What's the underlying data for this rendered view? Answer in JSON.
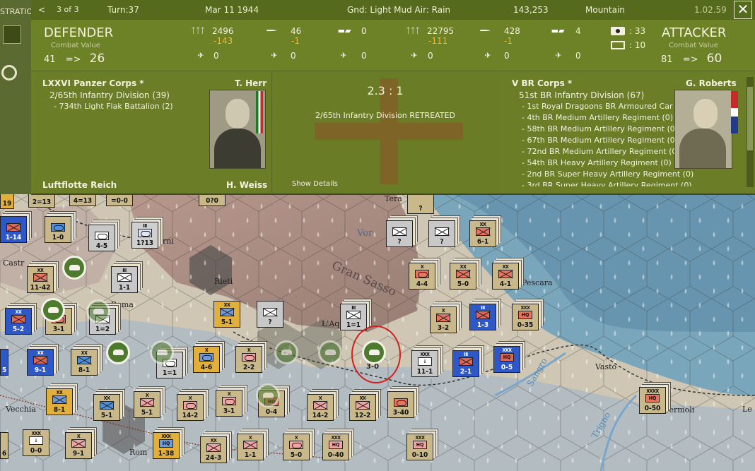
{
  "topbar": {
    "left_title": "STRATIO",
    "nav_prev": "<",
    "page": "3 of 3",
    "turn": "Turn:37",
    "date": "Mar 11 1944",
    "ground": "Gnd: Light Mud  Air: Rain",
    "hex_coord": "143,253",
    "terrain": "Mountain",
    "version": "1.02.59",
    "close": "✕"
  },
  "defender": {
    "heading": "DEFENDER",
    "sub": "Combat Value",
    "cv_from": "41",
    "arrow": "=>",
    "cv_to": "26",
    "men": "2496",
    "men_delta": "-143",
    "guns": "46",
    "guns_delta": "-1",
    "tanks": "0",
    "air1": "0",
    "air2": "0",
    "air3": "0",
    "corps": "LXXVI Panzer Corps *",
    "commander": "T. Herr",
    "division": "2/65th Infantry Division (39)",
    "attached": "- 734th Light Flak Battalion (2)",
    "air_group": "Luftflotte Reich",
    "air_cmdr": "H. Weiss"
  },
  "attacker": {
    "heading": "ATTACKER",
    "sub": "Combat Value",
    "cv_from": "81",
    "arrow": "=>",
    "cv_to": "60",
    "men": "22795",
    "men_delta": "-111",
    "guns": "428",
    "guns_delta": "-1",
    "tanks": "4",
    "air1": "0",
    "air2": "0",
    "air3": "0",
    "fort_value": ": 33",
    "entrench_value": ": 10",
    "corps": "V BR Corps *",
    "commander": "G. Roberts",
    "division": "51st BR Infantry Division (67)",
    "attached": [
      "- 1st Royal Dragoons BR Armoured Car Regiment (8)",
      "- 4th BR Medium Artillery Regiment (0)",
      "- 58th BR Medium Artillery Regiment (0)",
      "- 67th BR Medium Artillery Regiment (0)",
      "- 72nd BR Medium Artillery Regiment (0)",
      "- 54th BR Heavy Artillery Regiment (0)",
      "- 2nd BR Super Heavy Artillery Regiment (0)",
      "- 3rd BR Super Heavy Artillery Regiment (0)"
    ]
  },
  "result": {
    "odds": "2.3 : 1",
    "message": "2/65th Infantry Division RETREATED",
    "details_link": "Show Details"
  },
  "map": {
    "labels": [
      "Rieti",
      "L'Aq",
      "Gran Sasso",
      "Vasto",
      "Pescara",
      "Termoli",
      "Tera",
      "Castr",
      "Roma",
      "Rom",
      "Vecchia",
      "Le",
      "rni",
      "Sangro",
      "Trigno",
      "Vor"
    ],
    "units": [
      {
        "type": "u-blu",
        "size": "",
        "sym": "x",
        "val": "1-14"
      },
      {
        "type": "u-tan",
        "size": "",
        "sym": "ar",
        "val": "1-0"
      },
      {
        "type": "u-wht",
        "size": "",
        "sym": "ar",
        "val": "4-5"
      },
      {
        "type": "u-gray",
        "size": "III",
        "sym": "ar",
        "val": "1?13"
      },
      {
        "type": "u-tan",
        "size": "XX",
        "sym": "x",
        "val": "11-42"
      },
      {
        "type": "u-wht",
        "size": "III",
        "sym": "x",
        "val": "1-1"
      },
      {
        "type": "u-blu",
        "size": "XX",
        "sym": "x",
        "val": "5-2"
      },
      {
        "type": "u-tan",
        "size": "",
        "sym": "ar",
        "val": "3-1"
      },
      {
        "type": "u-wht",
        "size": "",
        "sym": "x",
        "val": "1=2"
      },
      {
        "type": "u-yel",
        "size": "XX",
        "sym": "x",
        "val": "5-1"
      },
      {
        "type": "u-wht",
        "size": "",
        "sym": "x",
        "val": "?"
      },
      {
        "type": "u-wht",
        "size": "III",
        "sym": "x",
        "val": "1=1"
      },
      {
        "type": "u-wht",
        "size": "",
        "sym": "x",
        "val": "?"
      },
      {
        "type": "u-wht",
        "size": "",
        "sym": "x",
        "val": "?"
      },
      {
        "type": "u-tan",
        "size": "XX",
        "sym": "x",
        "val": "6-1"
      },
      {
        "type": "u-tan",
        "size": "X",
        "sym": "ar",
        "val": "4-4"
      },
      {
        "type": "u-tan",
        "size": "XX",
        "sym": "x",
        "val": "5-0"
      },
      {
        "type": "u-tan",
        "size": "XX",
        "sym": "x",
        "val": "4-1"
      },
      {
        "type": "u-tan",
        "size": "X",
        "sym": "x",
        "val": "3-2"
      },
      {
        "type": "u-blu",
        "size": "III",
        "sym": "x",
        "val": "1-3"
      },
      {
        "type": "u-tan",
        "size": "XXX",
        "sym": "hq",
        "val": "0-35"
      },
      {
        "type": "u-blu",
        "size": "XX",
        "sym": "x",
        "val": "9-1"
      },
      {
        "type": "u-gb",
        "size": "XX",
        "sym": "x",
        "val": "8-1"
      },
      {
        "type": "u-wht",
        "size": "",
        "sym": "ar",
        "val": "1=1"
      },
      {
        "type": "u-yel",
        "size": "X",
        "sym": "ar",
        "val": "4-6"
      },
      {
        "type": "u-pink",
        "size": "X",
        "sym": "ar",
        "val": "2-2"
      },
      {
        "type": "u-wht",
        "size": "XXX",
        "sym": "hq",
        "val": "11-1"
      },
      {
        "type": "u-blu",
        "size": "III",
        "sym": "x",
        "val": "2-1"
      },
      {
        "type": "u-blu",
        "size": "XXX",
        "sym": "hq",
        "val": "0-5"
      },
      {
        "type": "u-yel",
        "size": "XX",
        "sym": "x",
        "val": "8-1"
      },
      {
        "type": "u-gb",
        "size": "XX",
        "sym": "x",
        "val": "5-1"
      },
      {
        "type": "u-pink",
        "size": "X",
        "sym": "x",
        "val": "5-1"
      },
      {
        "type": "u-pink",
        "size": "X",
        "sym": "ar",
        "val": "14-2"
      },
      {
        "type": "u-pink",
        "size": "X",
        "sym": "ar",
        "val": "3-1"
      },
      {
        "type": "u-tan",
        "size": "",
        "sym": "hq",
        "val": "0-4"
      },
      {
        "type": "u-pink",
        "size": "X",
        "sym": "x",
        "val": "14-2"
      },
      {
        "type": "u-pink",
        "size": "XX",
        "sym": "x",
        "val": "12-2"
      },
      {
        "type": "u-tan",
        "size": "",
        "sym": "ar",
        "val": "3-40"
      },
      {
        "type": "u-tan",
        "size": "XXXX",
        "sym": "hq",
        "val": "0-50"
      },
      {
        "type": "u-tan",
        "size": "XXX",
        "sym": "hq",
        "val": "0-0"
      },
      {
        "type": "u-pink",
        "size": "X",
        "sym": "x",
        "val": "9-1"
      },
      {
        "type": "u-yel",
        "size": "XXX",
        "sym": "hq",
        "val": "1-38"
      },
      {
        "type": "u-pink",
        "size": "XX",
        "sym": "x",
        "val": "24-3"
      },
      {
        "type": "u-pink",
        "size": "X",
        "sym": "x",
        "val": "1-1"
      },
      {
        "type": "u-pink",
        "size": "X",
        "sym": "ar",
        "val": "5-0"
      },
      {
        "type": "u-pink",
        "size": "XXX",
        "sym": "hq",
        "val": "0-40"
      },
      {
        "type": "u-pink",
        "size": "XXX",
        "sym": "hq",
        "val": "0-10"
      },
      {
        "type": "u-tan",
        "size": "",
        "sym": "x",
        "val": "?"
      },
      {
        "type": "u-tan",
        "size": "",
        "sym": "x",
        "val": "0?0"
      },
      {
        "type": "u-tan",
        "size": "",
        "sym": "x",
        "val": "4=13"
      },
      {
        "type": "u-tan",
        "size": "",
        "sym": "x",
        "val": "2=13"
      },
      {
        "type": "u-tan",
        "size": "",
        "sym": "x",
        "val": "=0-0"
      },
      {
        "type": "u-yel",
        "size": "",
        "sym": "x",
        "val": "19"
      },
      {
        "type": "u-blu",
        "size": "",
        "sym": "x",
        "val": "5"
      },
      {
        "type": "u-tan",
        "size": "",
        "sym": "x",
        "val": "6"
      }
    ],
    "attacking_unit_val": "3-0",
    "dual_status": "0-0"
  }
}
